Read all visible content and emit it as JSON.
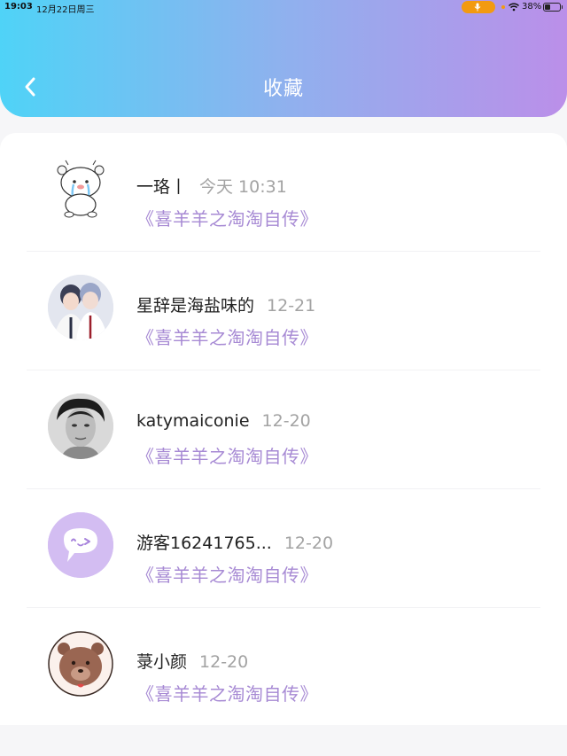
{
  "status_bar": {
    "time": "19:03",
    "date": "12月22日周三",
    "battery": "38%",
    "battery_level": 0.38
  },
  "header": {
    "title": "收藏"
  },
  "colors": {
    "gradient_start": "#4fd3f7",
    "gradient_end": "#bb8fe9",
    "link": "#a78ad4",
    "time": "#a3a3a3"
  },
  "favorites": [
    {
      "name": "一珞丨",
      "time": "今天 10:31",
      "book": "《喜羊羊之淘淘自传》",
      "avatar": "crying-bear-avatar"
    },
    {
      "name": "星辞是海盐味的",
      "time": "12-21",
      "book": "《喜羊羊之淘淘自传》",
      "avatar": "two-boys-photo-avatar"
    },
    {
      "name": "katymaiconie",
      "time": "12-20",
      "book": "《喜羊羊之淘淘自传》",
      "avatar": "bw-portrait-avatar"
    },
    {
      "name": "游客16241765...",
      "time": "12-20",
      "book": "《喜羊羊之淘淘自传》",
      "avatar": "guest-chat-avatar"
    },
    {
      "name": "菉小颜",
      "time": "12-20",
      "book": "《喜羊羊之淘淘自传》",
      "avatar": "brown-bear-avatar"
    }
  ]
}
